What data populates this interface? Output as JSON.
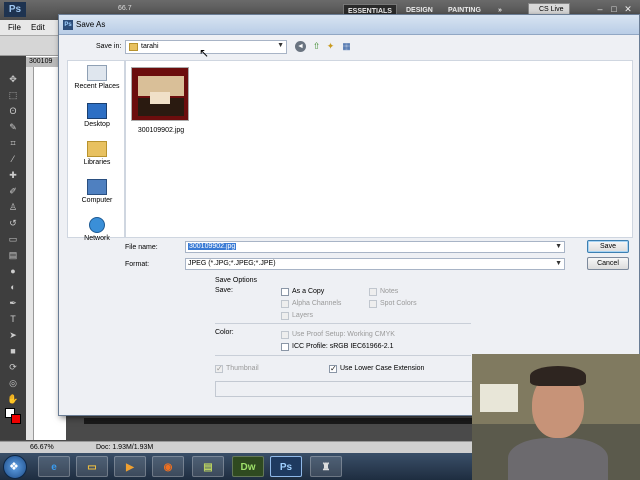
{
  "photoshop": {
    "logo": "Ps",
    "zoom": "66.7",
    "workspaces": [
      "ESSENTIALS",
      "DESIGN",
      "PAINTING",
      "»"
    ],
    "cs_live": "CS Live",
    "menu": [
      "File",
      "Edit"
    ],
    "doc_tab": "300109",
    "status_zoom": "66.67%",
    "status_doc": "Doc: 1.93M/1.93M"
  },
  "dialog": {
    "title": "Save As",
    "save_in_label": "Save in:",
    "save_in_value": "tarahi",
    "places": [
      "Recent Places",
      "Desktop",
      "Libraries",
      "Computer",
      "Network"
    ],
    "file": {
      "name": "300109902.jpg"
    },
    "file_name_label": "File name:",
    "file_name_value": "300109902.jpg",
    "format_label": "Format:",
    "format_value": "JPEG (*.JPG;*.JPEG;*.JPE)",
    "save_button": "Save",
    "cancel_button": "Cancel",
    "save_options_title": "Save Options",
    "save_label": "Save:",
    "options": {
      "as_copy": "As a Copy",
      "notes": "Notes",
      "alpha_channels": "Alpha Channels",
      "spot_colors": "Spot Colors",
      "layers": "Layers"
    },
    "color_label": "Color:",
    "use_proof_setup": "Use Proof Setup:  Working CMYK",
    "icc_profile": "ICC Profile:  sRGB IEC61966-2.1",
    "thumbnail": "Thumbnail",
    "lower_case": "Use Lower Case Extension"
  },
  "taskbar": {
    "apps": [
      "Dw",
      "Ps"
    ]
  }
}
